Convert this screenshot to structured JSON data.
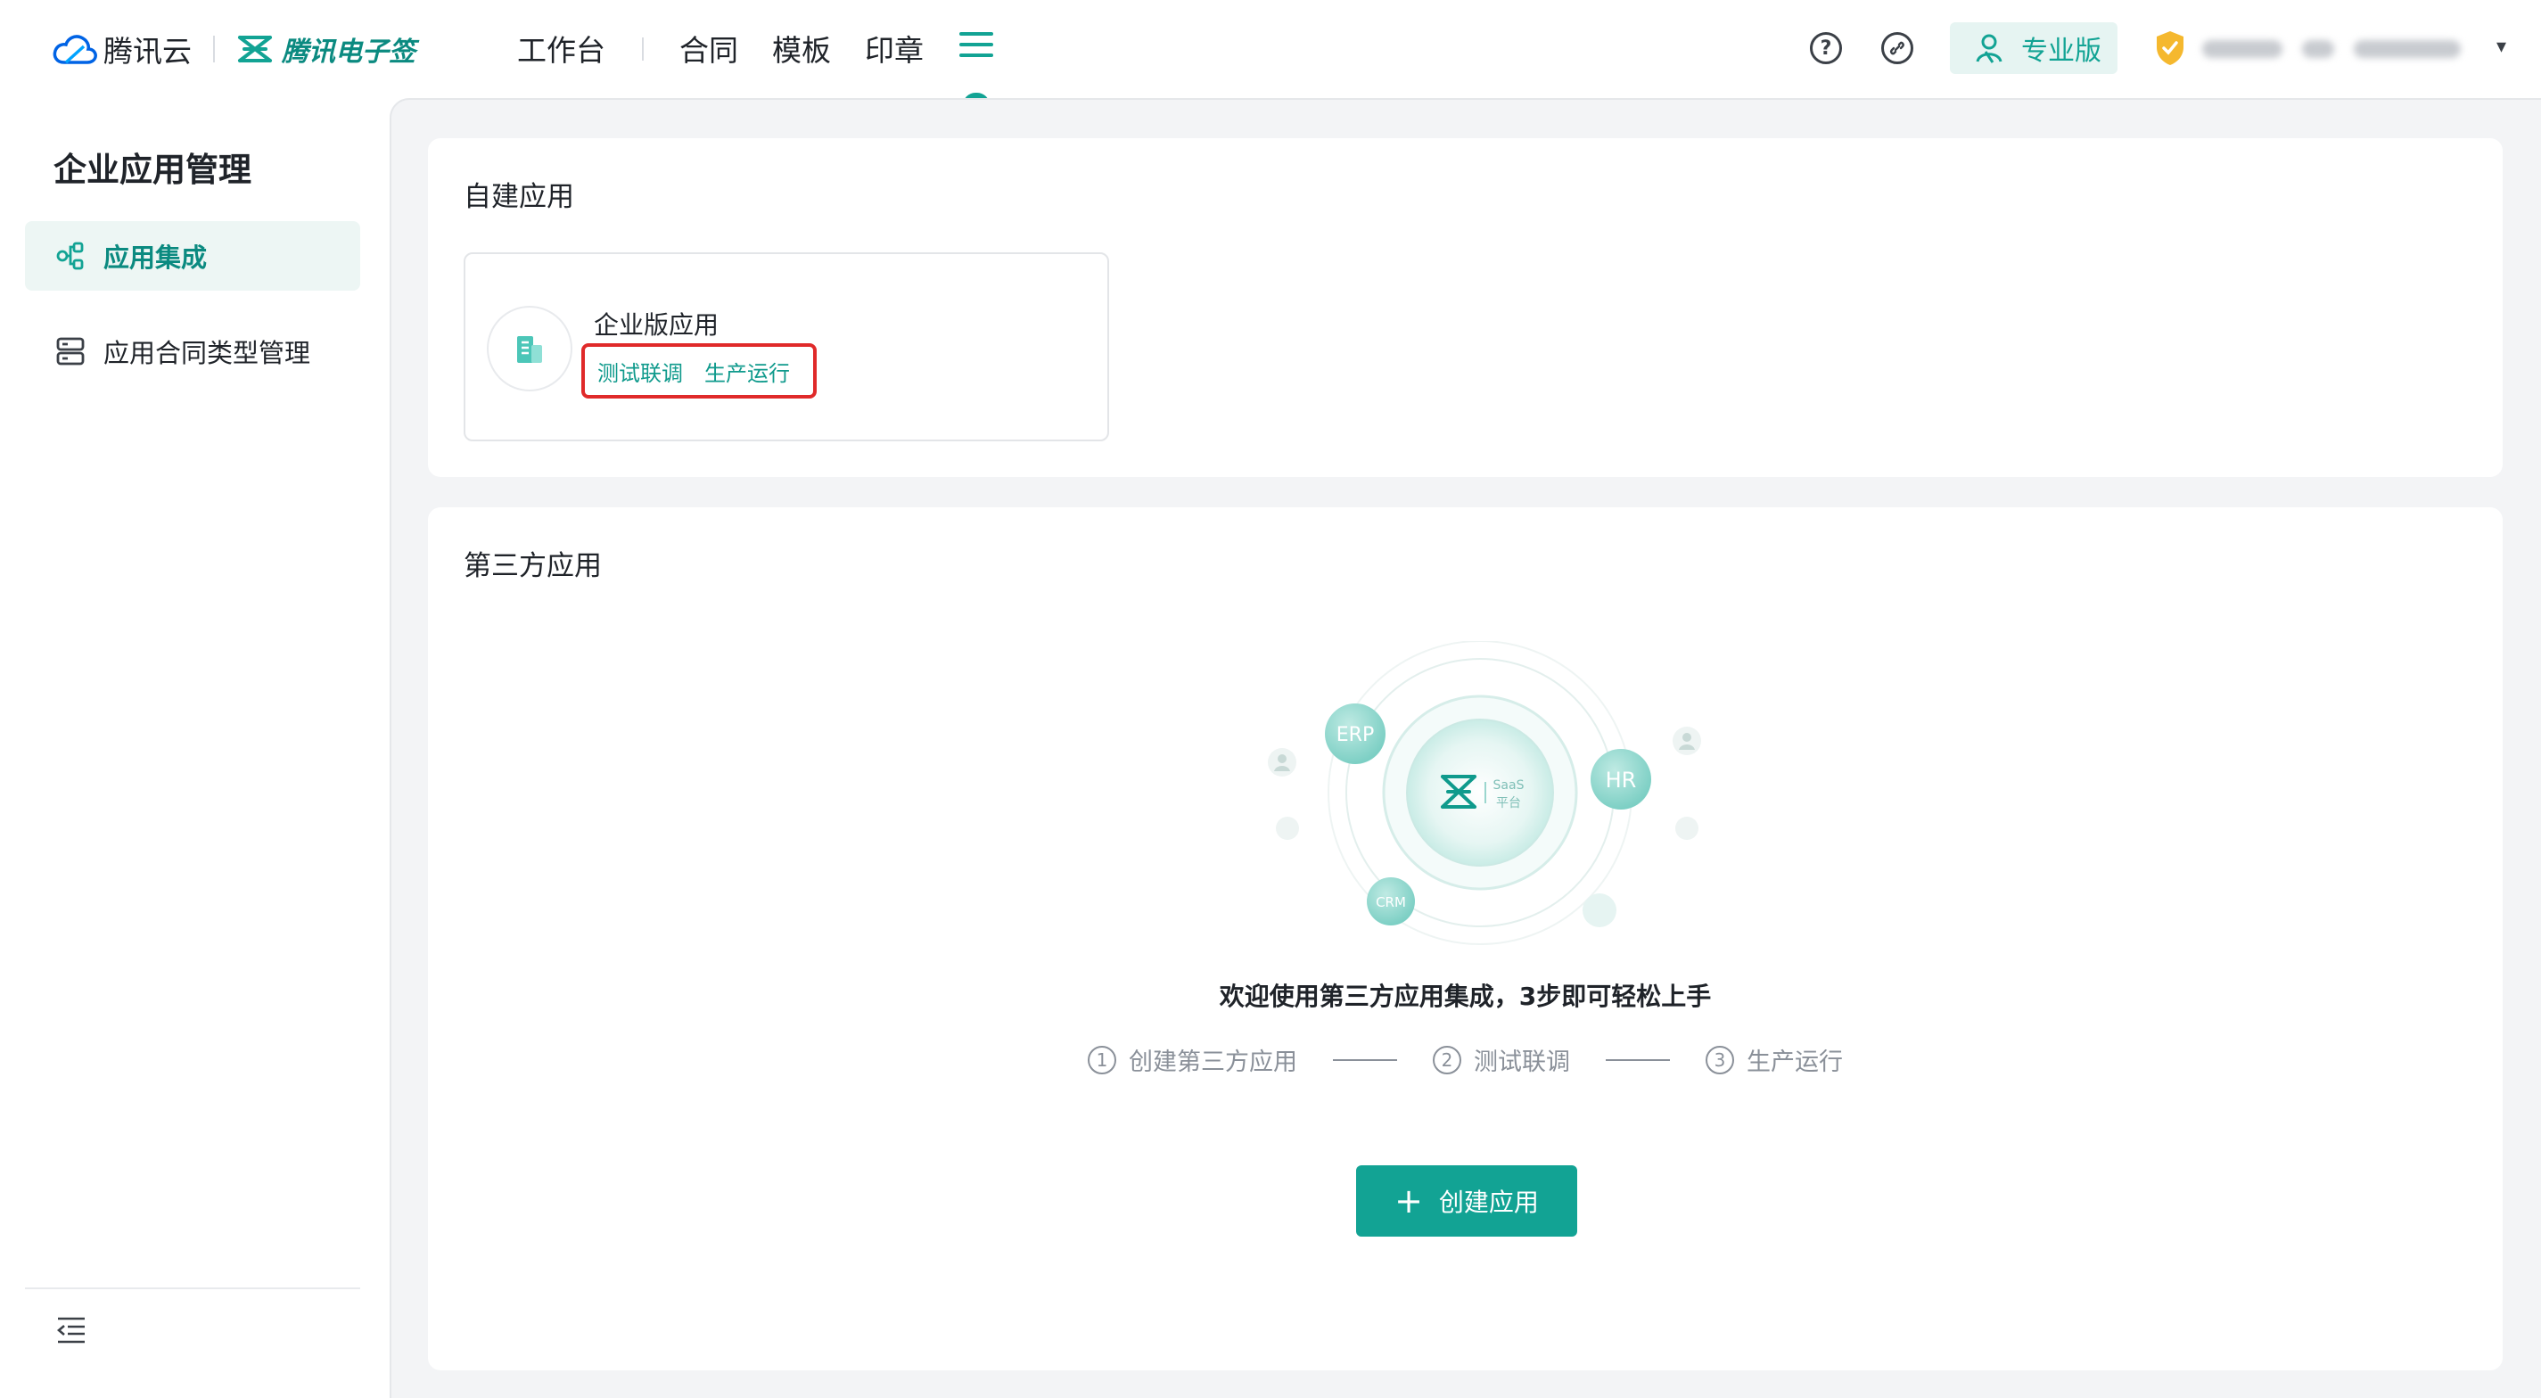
{
  "header": {
    "brand_tencent_cloud": "腾讯云",
    "brand_esign": "腾讯电子签",
    "nav": {
      "workbench": "工作台",
      "contract": "合同",
      "template": "模板",
      "seal": "印章"
    },
    "help_glyph": "?",
    "pro_badge_label": "专业版",
    "account_caret": "▾"
  },
  "sidebar": {
    "title": "企业应用管理",
    "items": [
      {
        "label": "应用集成",
        "icon": "integration-icon",
        "active": true
      },
      {
        "label": "应用合同类型管理",
        "icon": "contract-type-icon",
        "active": false
      }
    ]
  },
  "self_built": {
    "title": "自建应用",
    "card": {
      "name": "企业版应用",
      "links": [
        "测试联调",
        "生产运行"
      ]
    }
  },
  "third_party": {
    "title": "第三方应用",
    "illustration": {
      "erp": "ERP",
      "hr": "HR",
      "crm": "CRM",
      "saas_line1": "SaaS",
      "saas_line2": "平台"
    },
    "welcome": "欢迎使用第三方应用集成，3步即可轻松上手",
    "steps": [
      {
        "num": "1",
        "label": "创建第三方应用"
      },
      {
        "num": "2",
        "label": "测试联调"
      },
      {
        "num": "3",
        "label": "生产运行"
      }
    ],
    "create_button": {
      "plus": "+",
      "label": "创建应用"
    }
  },
  "colors": {
    "accent": "#12a394",
    "accent_dark": "#0b8a80",
    "highlight_box": "#e02a2a",
    "shield": "#f5b82e"
  }
}
